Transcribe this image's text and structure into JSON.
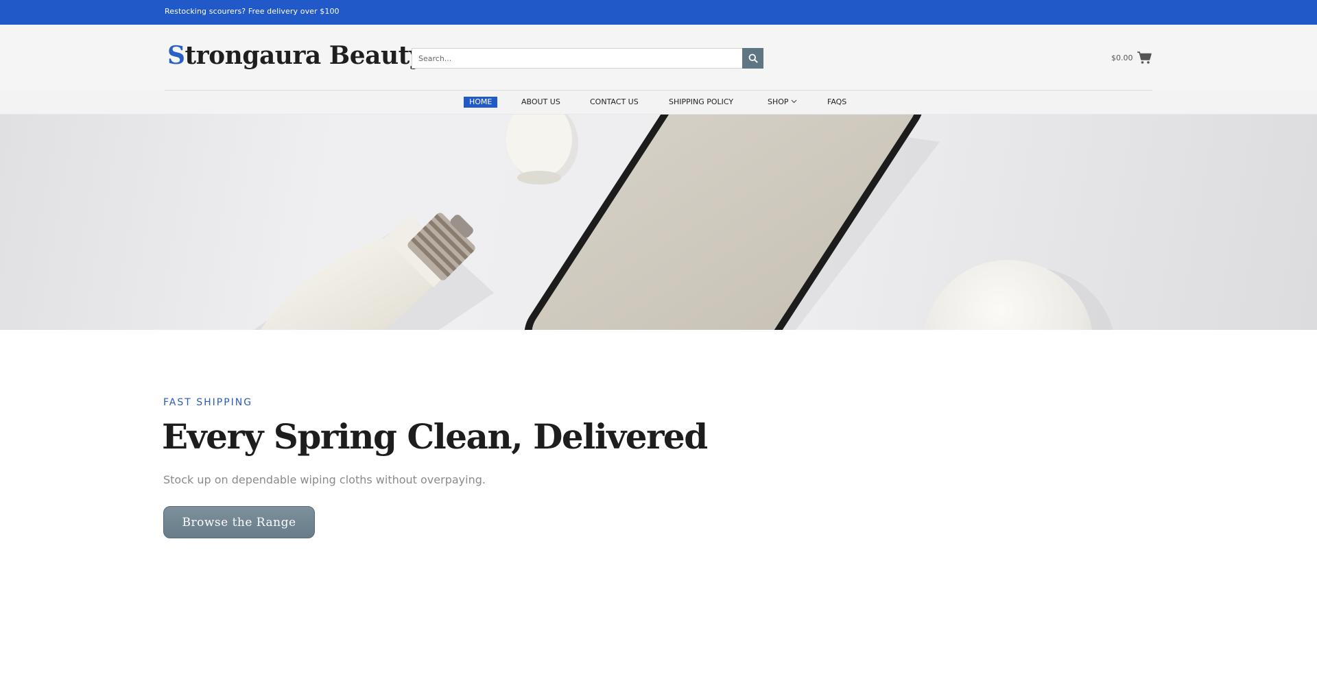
{
  "announcement": {
    "text": "Restocking scourers? Free delivery over $100"
  },
  "header": {
    "logo": {
      "initial": "S",
      "rest": "trongaura Beauty"
    },
    "search": {
      "placeholder": "Search..."
    },
    "cart": {
      "total": "$0.00"
    }
  },
  "nav": {
    "items": [
      {
        "label": "HOME",
        "active": true
      },
      {
        "label": "ABOUT US"
      },
      {
        "label": "CONTACT US"
      },
      {
        "label": "SHIPPING POLICY"
      },
      {
        "label": "SHOP",
        "has_dropdown": true
      },
      {
        "label": "FAQS"
      }
    ]
  },
  "hero_banner": {
    "image_subject": "smart bulbs and smartphone on white surface"
  },
  "promo": {
    "eyebrow": "FAST SHIPPING",
    "headline": "Every Spring Clean, Delivered",
    "subtext": "Stock up on dependable wiping cloths without overpaying.",
    "cta_label": "Browse the Range"
  },
  "colors": {
    "brand_blue": "#2259c9",
    "button_slate": "#687c89",
    "search_button": "#607583"
  }
}
